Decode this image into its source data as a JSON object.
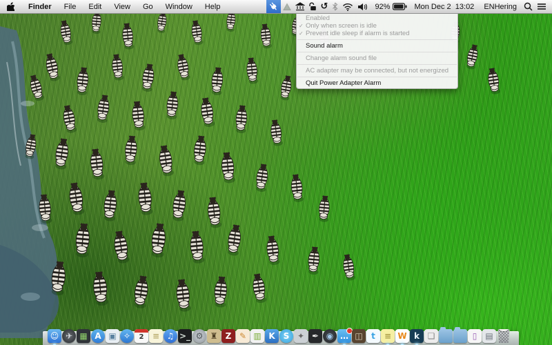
{
  "menu_bar": {
    "app_menu": "Finder",
    "items": [
      "File",
      "Edit",
      "View",
      "Go",
      "Window",
      "Help"
    ],
    "apple_icon": "apple-logo"
  },
  "status_bar": {
    "battery_percent": "92%",
    "datetime": "Mon Dec 2  13:02",
    "user": "ENHering",
    "icons": [
      "power-plug-icon",
      "triangle-icon",
      "bank-icon",
      "unlock-icon",
      "history-icon",
      "bluetooth-icon",
      "wifi-icon",
      "volume-icon",
      "battery-icon",
      "spotlight-search-icon",
      "notification-center-icon"
    ],
    "highlight_color": "#3a78d0"
  },
  "menu_extra_dropdown": {
    "owner": "power-adapter-alarm",
    "checkmark_glyph": "✓",
    "items": [
      {
        "label": "Enabled",
        "disabled": true,
        "checked": false
      },
      {
        "label": "Only when screen is idle",
        "disabled": true,
        "checked": true
      },
      {
        "label": "Prevent idle sleep if alarm is started",
        "disabled": true,
        "checked": true
      },
      {
        "type": "separator"
      },
      {
        "label": "Sound alarm",
        "disabled": false,
        "checked": false
      },
      {
        "type": "separator"
      },
      {
        "label": "Change alarm sound file",
        "disabled": true,
        "checked": false
      },
      {
        "type": "separator"
      },
      {
        "label": "AC adapter may be connected, but not energized",
        "disabled": true,
        "checked": false
      },
      {
        "type": "separator"
      },
      {
        "label": "Quit Power Adapter Alarm",
        "disabled": false,
        "checked": false
      }
    ]
  },
  "dock": {
    "apps": [
      {
        "id": "finder",
        "label": "Finder",
        "glyph": "☺",
        "bg": "linear-gradient(180deg,#6db9f0,#2a6fd4)",
        "fg": "#ffffff",
        "running": true
      },
      {
        "id": "launchpad",
        "label": "Launchpad",
        "glyph": "✈",
        "bg": "radial-gradient(circle,#6a6f74,#23262a)",
        "fg": "#d8dde2",
        "shape": "circle"
      },
      {
        "id": "mission-control",
        "label": "Mission Control",
        "glyph": "▦",
        "bg": "#2f3338",
        "fg": "#8fd06a"
      },
      {
        "id": "app-store",
        "label": "App Store",
        "glyph": "A",
        "bg": "linear-gradient(180deg,#5fb4ec,#2f7cd8)",
        "fg": "#ffffff",
        "shape": "circle"
      },
      {
        "id": "preview",
        "label": "Preview",
        "glyph": "▣",
        "bg": "#e8eef3",
        "fg": "#5b82a0"
      },
      {
        "id": "safari",
        "label": "Safari",
        "glyph": "✧",
        "bg": "linear-gradient(180deg,#63b6f0,#2d77d2)",
        "fg": "#ffffff",
        "shape": "circle"
      },
      {
        "id": "calendar",
        "label": "Calendar",
        "glyph": "2",
        "bg": "#f8f8f8",
        "fg": "#333333",
        "type": "calendar"
      },
      {
        "id": "notes",
        "label": "Notes",
        "glyph": "≡",
        "bg": "#f8f4da",
        "fg": "#b9ab6d"
      },
      {
        "id": "itunes",
        "label": "iTunes",
        "glyph": "♫",
        "bg": "linear-gradient(180deg,#5fa8ef,#2f6fd6)",
        "fg": "#ffffff",
        "shape": "circle"
      },
      {
        "id": "terminal",
        "label": "Terminal",
        "glyph": ">_",
        "bg": "#1c1e20",
        "fg": "#cfd8d2"
      },
      {
        "id": "system-preferences",
        "label": "System Preferences",
        "glyph": "⚙",
        "bg": "radial-gradient(circle,#cdd2d6,#8e959b)",
        "fg": "#4d5358",
        "shape": "circle"
      },
      {
        "id": "building-game",
        "label": "Building App",
        "glyph": "♜",
        "bg": "#cfbd8f",
        "fg": "#4e4026"
      },
      {
        "id": "zotero",
        "label": "Zotero",
        "glyph": "Z",
        "bg": "#8e1f1f",
        "fg": "#ffffff"
      },
      {
        "id": "text-editor",
        "label": "Text Editor",
        "glyph": "✎",
        "bg": "#f7ead6",
        "fg": "#cc8833"
      },
      {
        "id": "charts",
        "label": "Charts App",
        "glyph": "▥",
        "bg": "#f2f2f2",
        "fg": "#77aa33"
      },
      {
        "id": "keynote",
        "label": "Keynote",
        "glyph": "K",
        "bg": "linear-gradient(180deg,#58a7e8,#2b6fc2)",
        "fg": "#ffffff"
      },
      {
        "id": "skype",
        "label": "Skype",
        "glyph": "S",
        "bg": "radial-gradient(circle,#7ed0f5,#35a3dd)",
        "fg": "#ffffff",
        "shape": "circle"
      },
      {
        "id": "keychain",
        "label": "Keys App",
        "glyph": "✦",
        "bg": "#ccd1d5",
        "fg": "#666666"
      },
      {
        "id": "pen-app",
        "label": "Pen App",
        "glyph": "✒",
        "bg": "#26282b",
        "fg": "#e8e8e8"
      },
      {
        "id": "camera-app",
        "label": "Camera App",
        "glyph": "◉",
        "bg": "radial-gradient(circle,#4b5056,#1e2124)",
        "fg": "#9fc6e8",
        "shape": "circle"
      },
      {
        "id": "messages",
        "label": "Messages",
        "glyph": "…",
        "bg": "linear-gradient(180deg,#6cc0f0,#2f8fdd)",
        "fg": "#ffffff",
        "badge": true,
        "running": true
      },
      {
        "id": "box-app",
        "label": "Box App",
        "glyph": "◫",
        "bg": "#584430",
        "fg": "#d9cfba"
      },
      {
        "id": "twitter",
        "label": "Twitter",
        "glyph": "t",
        "bg": "#f4fafe",
        "fg": "#3aa3e3"
      },
      {
        "id": "stickies",
        "label": "Stickies",
        "glyph": "≡",
        "bg": "#f6efa2",
        "fg": "#a89b45",
        "running": true
      },
      {
        "id": "w-app",
        "label": "W App",
        "glyph": "W",
        "bg": "#fdfdfd",
        "fg": "#e8891c",
        "running": true
      },
      {
        "id": "kindle",
        "label": "Kindle",
        "glyph": "k",
        "bg": "#173c54",
        "fg": "#eaf3f9",
        "running": true
      },
      {
        "id": "photos-stack",
        "label": "Photos",
        "glyph": "❏",
        "bg": "#ececec",
        "fg": "#888888"
      },
      {
        "id": "folder-1",
        "label": "Folder",
        "type": "folder"
      },
      {
        "id": "folder-2",
        "label": "Folder",
        "type": "folder"
      },
      {
        "id": "installer",
        "label": "Installer",
        "glyph": "▯",
        "bg": "#f6f6f6",
        "fg": "#9a5fb5"
      },
      {
        "id": "documents-stack",
        "label": "Documents",
        "glyph": "▤",
        "bg": "#e4e7ea",
        "fg": "#69707a"
      },
      {
        "id": "trash",
        "label": "Trash",
        "type": "trash"
      }
    ]
  },
  "colors": {
    "menu_highlight": "#3a78d0",
    "menu_disabled_text": "#9b9b9b",
    "grass_green": "#449124",
    "water_teal": "#4f6d7a"
  }
}
